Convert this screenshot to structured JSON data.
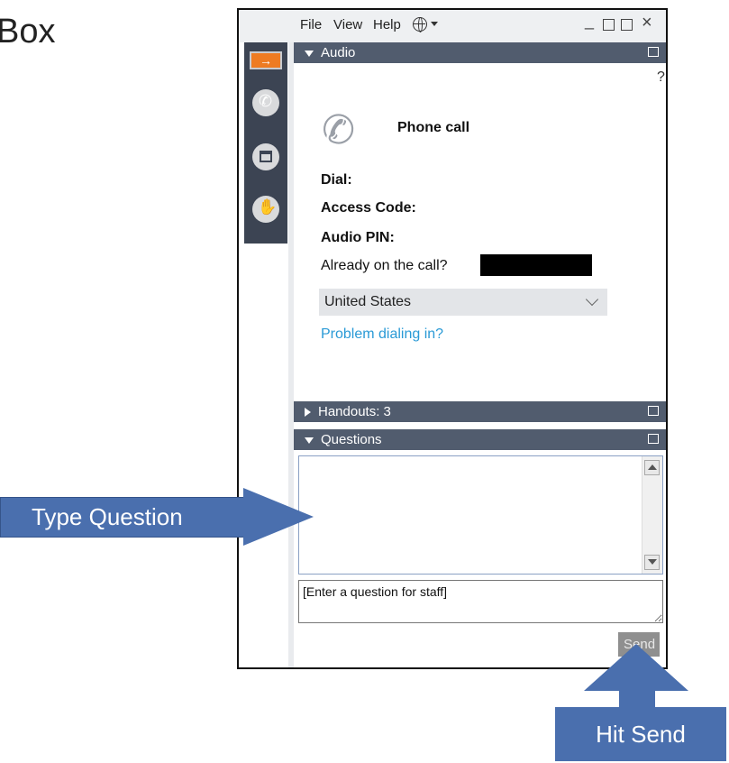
{
  "slide": {
    "title": "Box"
  },
  "menubar": {
    "file": "File",
    "view": "View",
    "help": "Help",
    "language_icon": "globe-icon"
  },
  "window_controls": {
    "minimize": "_",
    "close": "×"
  },
  "audio": {
    "header": "Audio",
    "help": "?",
    "phone_title": "Phone call",
    "dial_label": "Dial:",
    "access_code_label": "Access Code:",
    "audio_pin_label": "Audio PIN:",
    "already_label": "Already on the call?",
    "country": "United States",
    "problem_link": "Problem dialing in?"
  },
  "handouts": {
    "header": "Handouts: 3"
  },
  "questions": {
    "header": "Questions",
    "input_value": "[Enter a question for staff]",
    "send_label": "Send"
  },
  "callouts": {
    "type_question": "Type Question",
    "hit_send": "Hit Send"
  },
  "colors": {
    "panel_header": "#515c6e",
    "accent_orange": "#ee7b22",
    "callout": "#4a6fae",
    "link": "#2a9ad6"
  }
}
